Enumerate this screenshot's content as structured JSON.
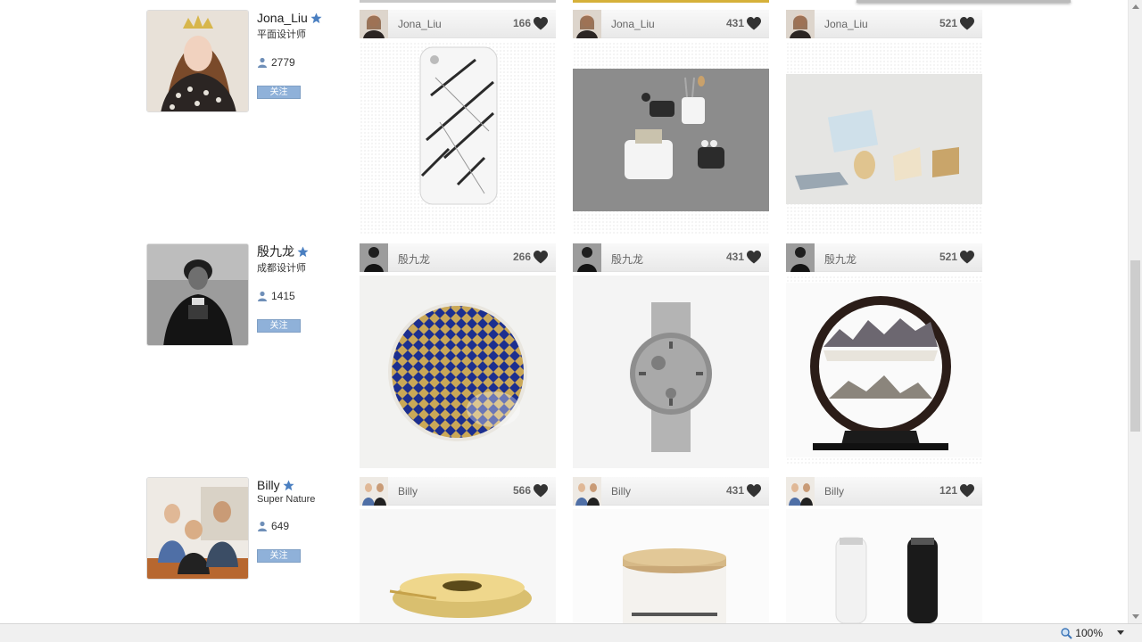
{
  "colors": {
    "follow_button": "#8fb1d9",
    "star": "#4a7fc1",
    "heart": "#333333"
  },
  "rows": [
    {
      "name": "Jona_Liu",
      "title": "平面设计师",
      "followers": "2779",
      "follow_label": "关注",
      "cards": [
        {
          "user": "Jona_Liu",
          "likes": "166",
          "image": "marble-phone-case"
        },
        {
          "user": "Jona_Liu",
          "likes": "431",
          "image": "wall-pockets"
        },
        {
          "user": "Jona_Liu",
          "likes": "521",
          "image": "photo-stands"
        }
      ]
    },
    {
      "name": "殷九龙",
      "title": "成都设计师",
      "followers": "1415",
      "follow_label": "关注",
      "cards": [
        {
          "user": "殷九龙",
          "likes": "266",
          "image": "diamond-plate"
        },
        {
          "user": "殷九龙",
          "likes": "431",
          "image": "bradley-watch"
        },
        {
          "user": "殷九龙",
          "likes": "521",
          "image": "sand-picture"
        }
      ]
    },
    {
      "name": "Billy",
      "title": "Super Nature",
      "followers": "649",
      "follow_label": "关注",
      "cards": [
        {
          "user": "Billy",
          "likes": "566",
          "image": "brass-dish"
        },
        {
          "user": "Billy",
          "likes": "431",
          "image": "candle-tin"
        },
        {
          "user": "Billy",
          "likes": "121",
          "image": "watch-straps"
        }
      ]
    }
  ],
  "status": {
    "zoom": "100%"
  }
}
